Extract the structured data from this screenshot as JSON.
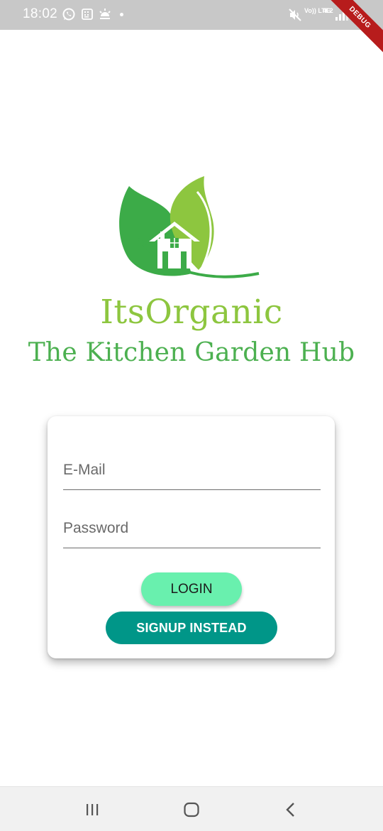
{
  "status_bar": {
    "time": "18:02",
    "volte": "Vo)) LTE2",
    "network": "4G",
    "icons": [
      "whatsapp-icon",
      "sim-icon",
      "weather-icon",
      "mute-icon",
      "signal-icon"
    ]
  },
  "debug_banner": "DEBUG",
  "brand": {
    "title": "ItsOrganic",
    "subtitle": "The Kitchen Garden Hub"
  },
  "login_form": {
    "email_placeholder": "E-Mail",
    "password_placeholder": "Password",
    "login_label": "LOGIN",
    "signup_label": "SIGNUP INSTEAD"
  },
  "nav_bar": {
    "icons": [
      "recents-icon",
      "home-icon",
      "back-icon"
    ]
  },
  "colors": {
    "leaf_light": "#8dc63f",
    "leaf_dark": "#3aaa46",
    "login_button": "#69f0ae",
    "signup_button": "#009688",
    "status_bar": "#c8c8c8"
  }
}
